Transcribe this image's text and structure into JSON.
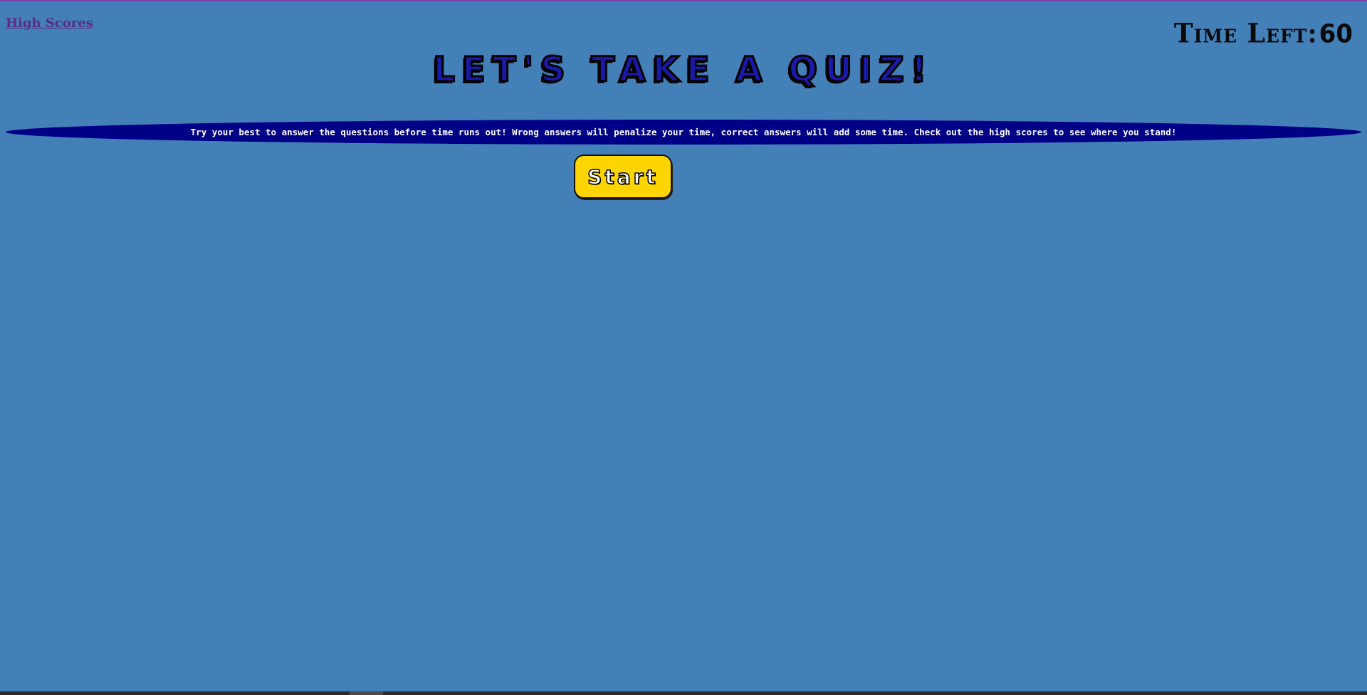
{
  "nav": {
    "high_scores_label": "High Scores"
  },
  "timer": {
    "label": "Time Left:",
    "value": "60"
  },
  "header": {
    "title": "Let's Take a Quiz!"
  },
  "intro": {
    "text": "Try your best to answer the questions before time runs out! Wrong answers will penalize your time, correct answers will add some time. Check out the high scores to see where you stand!"
  },
  "actions": {
    "start_label": "Start"
  },
  "colors": {
    "background": "#4380b8",
    "banner": "#000087",
    "start_button": "#ffd500",
    "link": "#5b2a8a",
    "title_fill": "#1a1aa8"
  }
}
